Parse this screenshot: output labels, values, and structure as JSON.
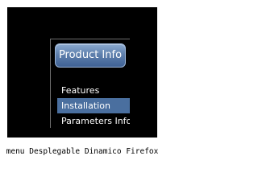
{
  "menu": {
    "button_label": "Product Info",
    "items": [
      {
        "label": "Features"
      },
      {
        "label": "Installation",
        "active": true
      },
      {
        "label": "Parameters Info"
      }
    ]
  },
  "caption": "menu Desplegable Dinamico Firefox",
  "colors": {
    "background": "#000000",
    "button_top": "#8aa9cf",
    "button_bottom": "#3f6194",
    "active_item": "#4a6f9f",
    "text": "#ffffff"
  }
}
